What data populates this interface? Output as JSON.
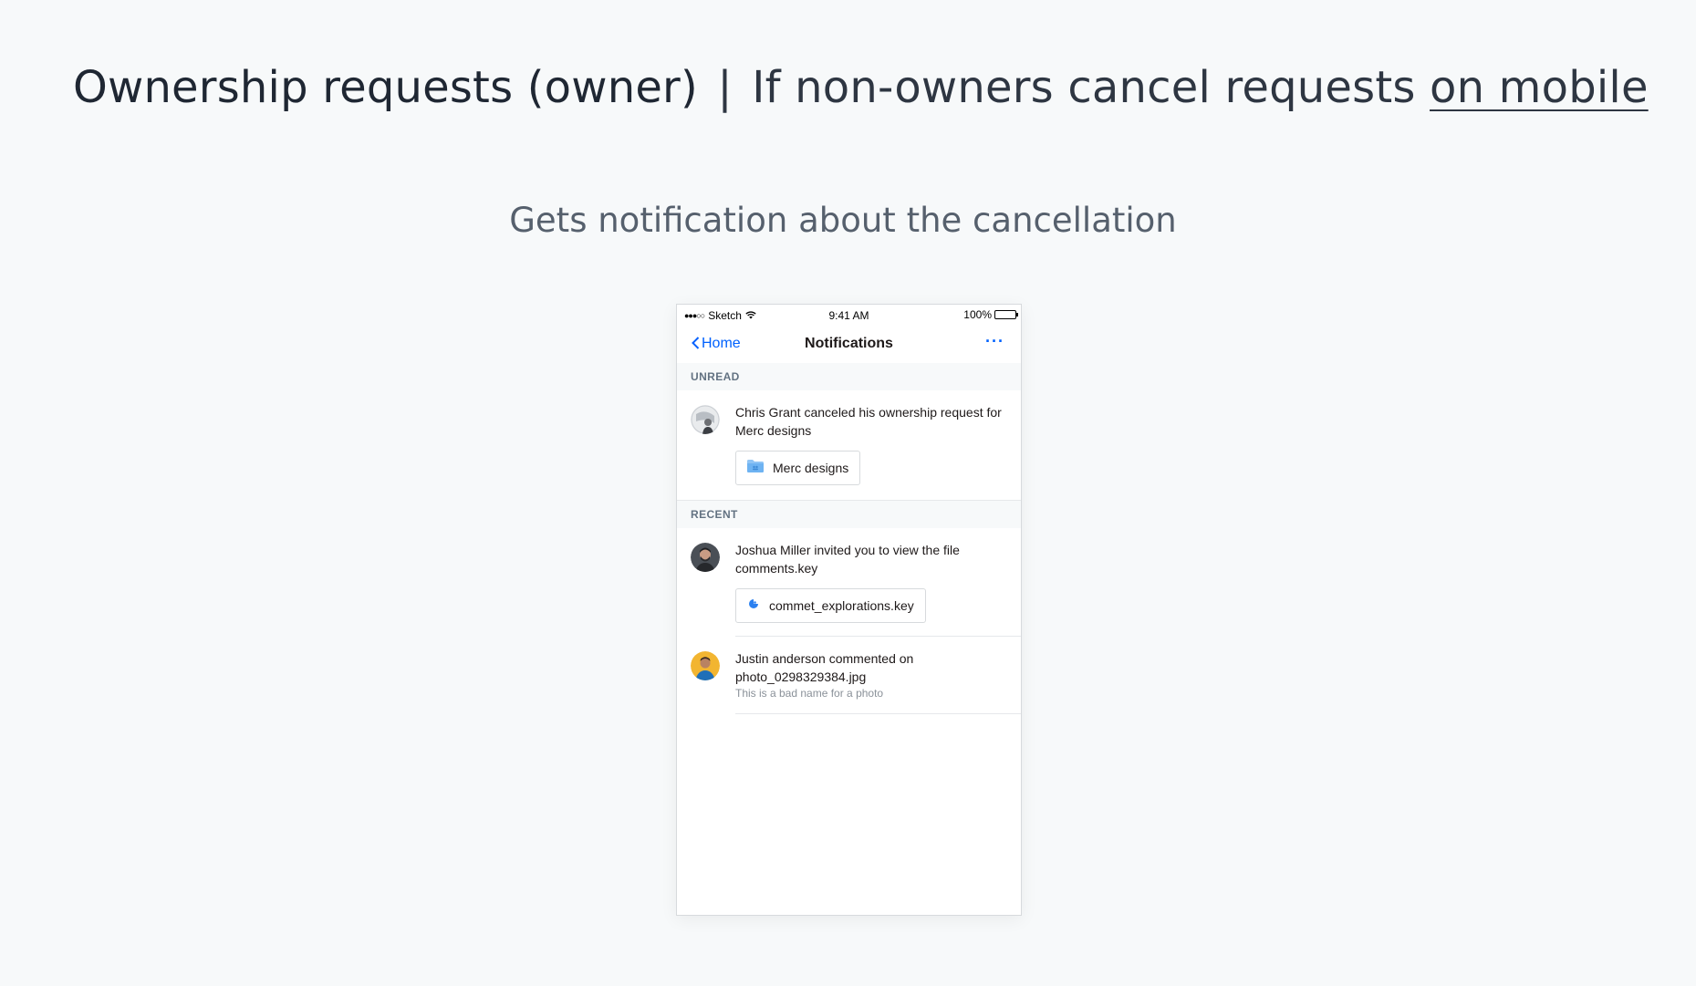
{
  "headline": {
    "strong": "Ownership requests (owner)",
    "separator": "|",
    "light": "If non-owners cancel requests",
    "link": "on mobile"
  },
  "subhead": "Gets notification about the cancellation",
  "phone": {
    "statusbar": {
      "carrier": "Sketch",
      "time": "9:41 AM",
      "battery": "100%",
      "battery_level": 1.0
    },
    "navbar": {
      "back_label": "Home",
      "title": "Notifications",
      "more": "···"
    },
    "sections": {
      "unread": {
        "label": "UNREAD",
        "item": {
          "text": "Chris Grant canceled his ownership request for Merc designs",
          "chip": "Merc designs"
        }
      },
      "recent": {
        "label": "RECENT",
        "items": [
          {
            "text": "Joshua Miller invited you to view the file comments.key",
            "chip": "commet_explorations.key"
          },
          {
            "text": "Justin anderson commented on photo_0298329384.jpg",
            "sub": "This is a bad name for a photo"
          }
        ]
      }
    }
  },
  "colors": {
    "accent": "#0061fe",
    "background": "#f7f9fa",
    "section_text": "#637282"
  },
  "icons": {
    "back": "chevron-left-icon",
    "more": "more-dots-icon",
    "wifi": "wifi-icon",
    "battery": "battery-icon",
    "folder": "shared-folder-icon",
    "keynote": "keynote-file-icon"
  }
}
